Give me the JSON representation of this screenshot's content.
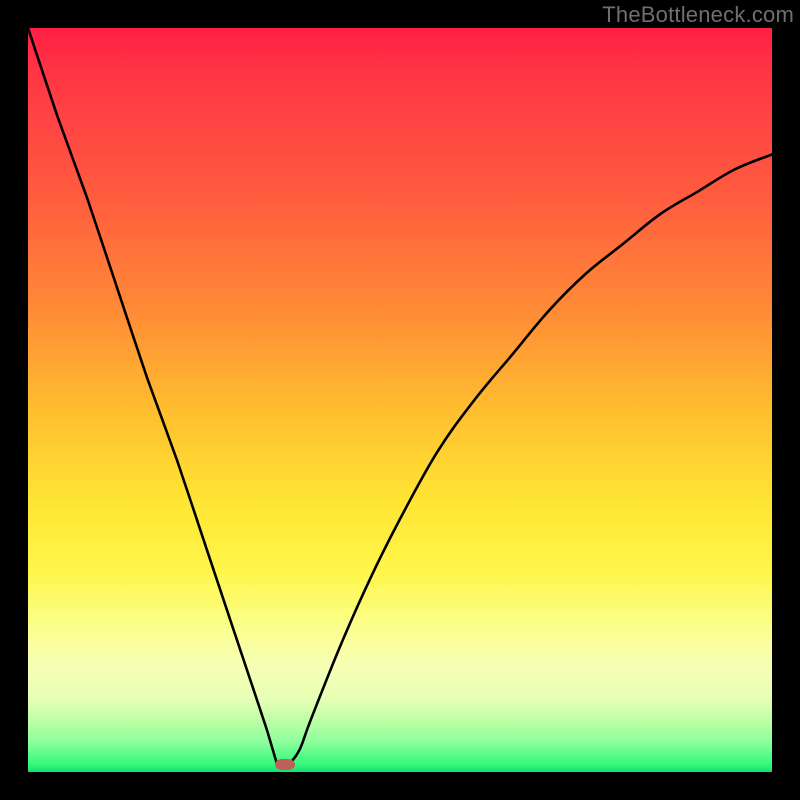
{
  "watermark": "TheBottleneck.com",
  "chart_data": {
    "type": "line",
    "title": "",
    "xlabel": "",
    "ylabel": "",
    "xlim": [
      0,
      100
    ],
    "ylim": [
      0,
      100
    ],
    "x": [
      0,
      4,
      8,
      12,
      16,
      20,
      24,
      28,
      32,
      33.5,
      34,
      35,
      36.5,
      38,
      42,
      46,
      50,
      55,
      60,
      65,
      70,
      75,
      80,
      85,
      90,
      95,
      100
    ],
    "values": [
      100,
      88,
      77,
      65,
      53,
      42,
      30,
      18,
      6,
      1,
      0.7,
      1,
      3,
      7,
      17,
      26,
      34,
      43,
      50,
      56,
      62,
      67,
      71,
      75,
      78,
      81,
      83
    ],
    "cusp": {
      "x": 34,
      "y": 0.7
    },
    "marker": {
      "x": 34.5,
      "y": 0.9
    },
    "background_gradient": {
      "top": "#ff1f44",
      "mid": "#ffe634",
      "bottom": "#10e06e"
    },
    "annotations": []
  }
}
